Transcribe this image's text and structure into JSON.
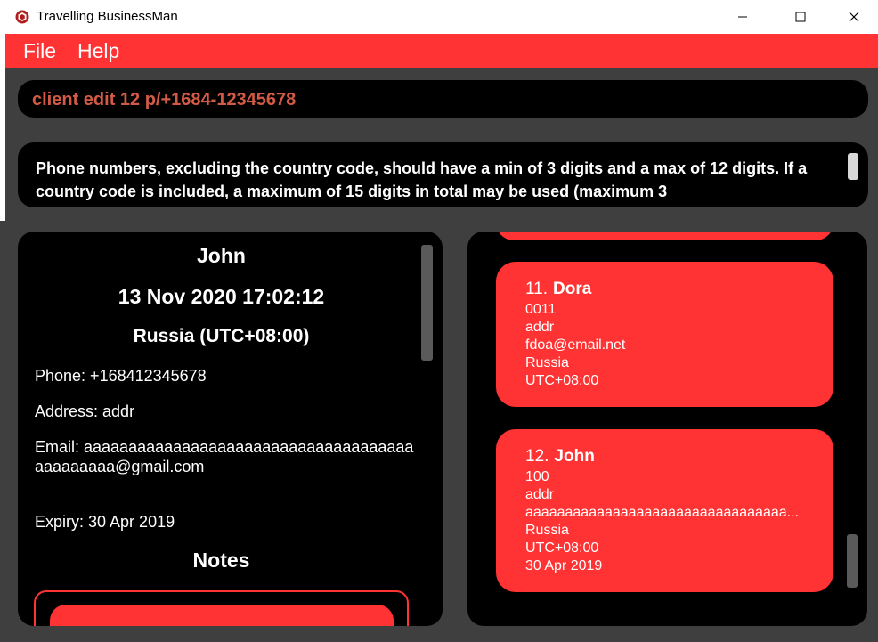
{
  "window": {
    "title": "Travelling BusinessMan",
    "icon": "app-logo-icon",
    "controls": [
      "minimize-icon",
      "maximize-icon",
      "close-icon"
    ]
  },
  "menu": {
    "file_label": "File",
    "help_label": "Help"
  },
  "command": {
    "value": "client edit 12 p/+1684-12345678"
  },
  "result": {
    "message": "Phone numbers, excluding the country code, should have a min of 3 digits and a max of 12 digits. If a country code is included, a maximum of 15 digits in total may be used (maximum 3"
  },
  "detail": {
    "name": "John",
    "time": "13 Nov 2020 17:02:12",
    "country": "Russia (UTC+08:00)",
    "phone": "Phone: +168412345678",
    "address": "Address: addr",
    "email": "Email: aaaaaaaaaaaaaaaaaaaaaaaaaaaaaaaaaaaaaaaaaaaaaa@gmail.com",
    "expiry": "Expiry: 30 Apr 2019",
    "notes_heading": "Notes"
  },
  "clients": [
    {
      "index": "11.",
      "name": "Dora",
      "phone": "0011",
      "address": "addr",
      "email": "fdoa@email.net",
      "country": "Russia",
      "timezone": "UTC+08:00"
    },
    {
      "index": "12.",
      "name": "John",
      "phone": "100",
      "address": "addr",
      "email": "aaaaaaaaaaaaaaaaaaaaaaaaaaaaaaaaa...",
      "country": "Russia",
      "timezone": "UTC+08:00",
      "expiry": "30 Apr 2019"
    }
  ],
  "colors": {
    "accent": "#ff3333",
    "background": "#3f3f3f",
    "panel": "#000000",
    "command_text": "#d35a45"
  }
}
